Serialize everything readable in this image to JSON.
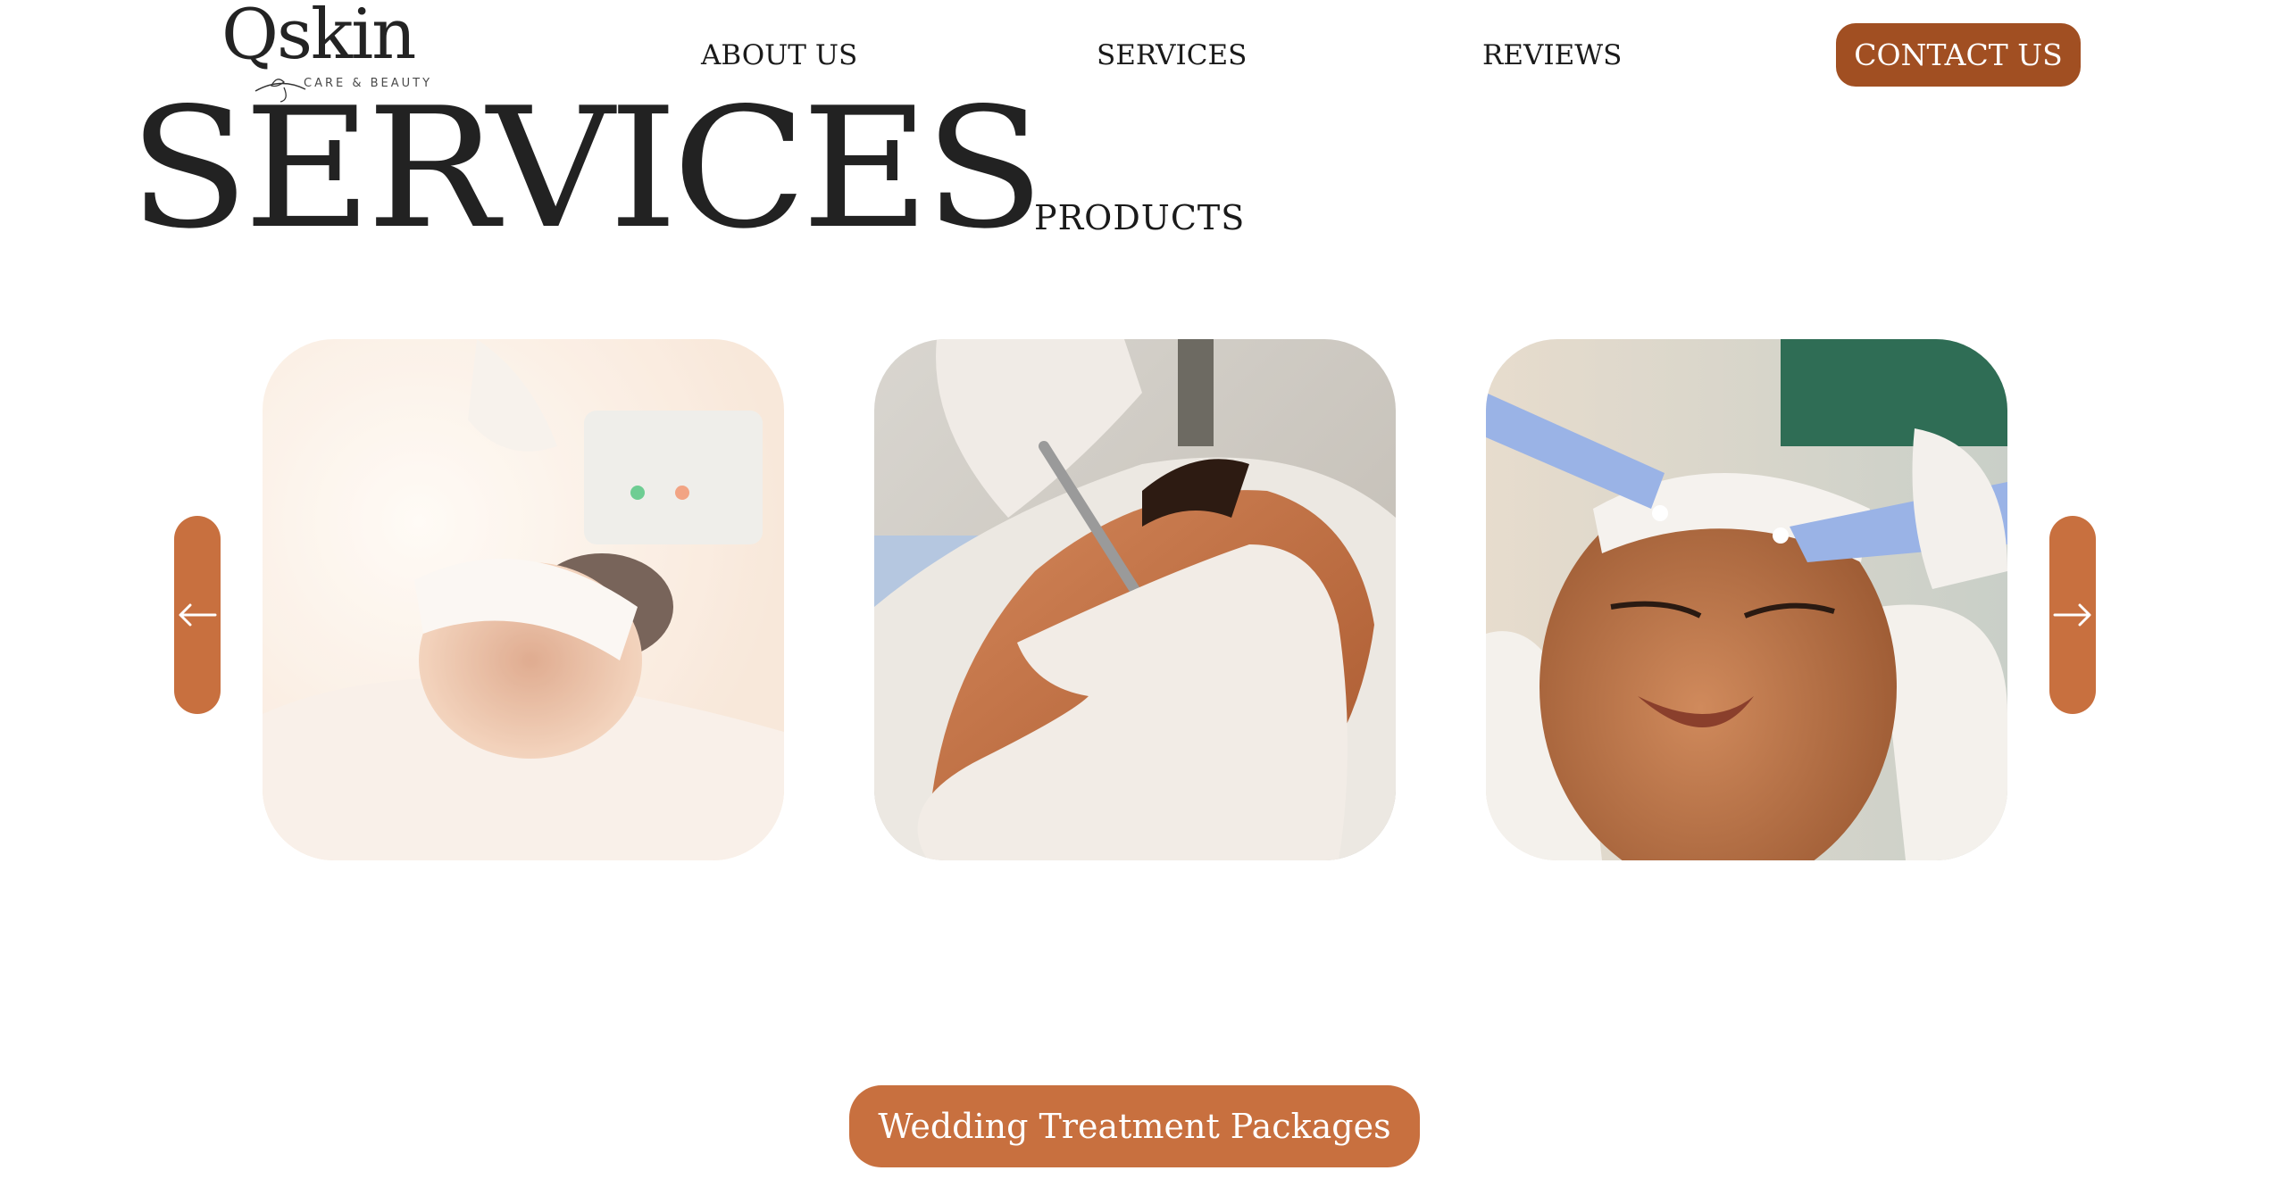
{
  "brand": {
    "logo_word": "Qskin",
    "logo_tagline": "CARE & BEAUTY"
  },
  "nav": {
    "items": [
      {
        "label": "ABOUT US"
      },
      {
        "label": "SERVICES"
      },
      {
        "label": "REVIEWS"
      }
    ],
    "contact_label": "CONTACT US"
  },
  "page": {
    "title": "SERVICES",
    "secondary_tab": "PRODUCTS"
  },
  "carousel": {
    "prev_icon": "arrow-left-icon",
    "next_icon": "arrow-right-icon",
    "slides": [
      {
        "image": "facial-steam-treatment-photo"
      },
      {
        "image": "dermaplaning-treatment-photo"
      },
      {
        "image": "microcurrent-facial-treatment-photo"
      }
    ]
  },
  "cta": {
    "label": "Wedding Treatment Packages"
  },
  "colors": {
    "contact_button": "#a14f22",
    "accent": "#c8703f",
    "text": "#1a1a1a",
    "background": "#ffffff"
  }
}
